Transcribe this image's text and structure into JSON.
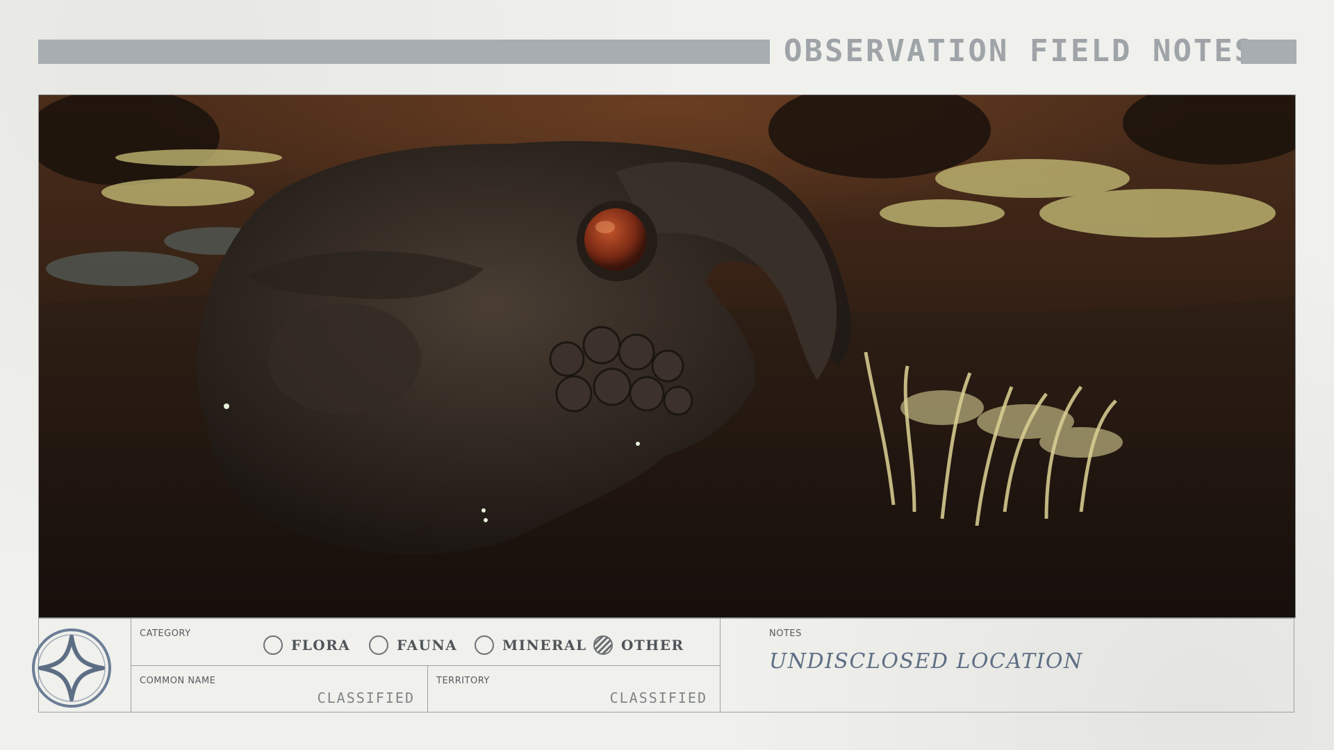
{
  "header": {
    "title": "OBSERVATION FIELD NOTES"
  },
  "photo": {
    "subject_icon": "creature-skull-photo"
  },
  "form": {
    "emblem_icon": "four-point-star-seal-icon",
    "category": {
      "label": "CATEGORY",
      "options": [
        {
          "label": "FLORA",
          "selected": false
        },
        {
          "label": "FAUNA",
          "selected": false
        },
        {
          "label": "MINERAL",
          "selected": false
        },
        {
          "label": "OTHER",
          "selected": true
        }
      ]
    },
    "common_name": {
      "label": "COMMON NAME",
      "value": "CLASSIFIED"
    },
    "territory": {
      "label": "TERRITORY",
      "value": "CLASSIFIED"
    },
    "notes": {
      "label": "NOTES",
      "value": "UNDISCLOSED LOCATION"
    }
  },
  "colors": {
    "paper": "#f0f0ec",
    "header_bar": "#a7adb1",
    "ink_blue": "#5d6d84",
    "label_gray": "#555a5e"
  }
}
